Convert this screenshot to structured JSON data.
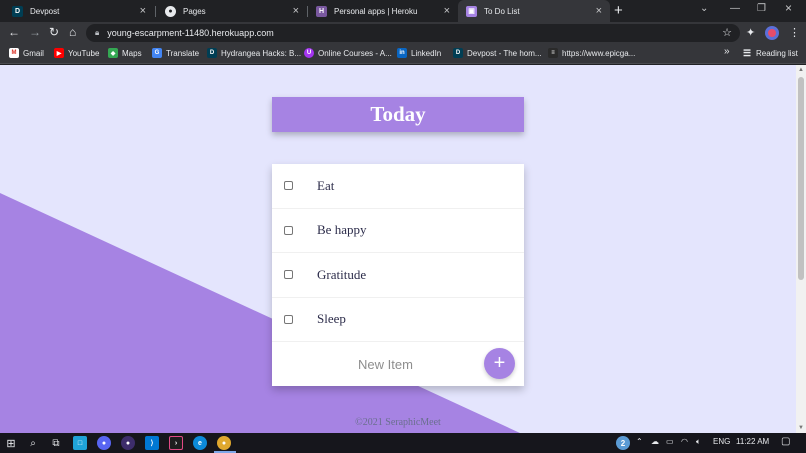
{
  "browser": {
    "tabs": [
      {
        "title": "Devpost",
        "icon": "devpost-icon",
        "active": false
      },
      {
        "title": "Pages",
        "icon": "github-icon",
        "active": false
      },
      {
        "title": "Personal apps | Heroku",
        "icon": "heroku-icon",
        "active": false
      },
      {
        "title": "To Do List",
        "icon": "todo-icon",
        "active": true
      }
    ],
    "url": "young-escarpment-11480.herokuapp.com",
    "bookmarks": [
      {
        "label": "Gmail",
        "icon": "gmail-icon"
      },
      {
        "label": "YouTube",
        "icon": "youtube-icon"
      },
      {
        "label": "Maps",
        "icon": "maps-icon"
      },
      {
        "label": "Translate",
        "icon": "translate-icon"
      },
      {
        "label": "Hydrangea Hacks: B...",
        "icon": "devpost-icon"
      },
      {
        "label": "Online Courses - A...",
        "icon": "online-courses-icon"
      },
      {
        "label": "LinkedIn",
        "icon": "linkedin-icon"
      },
      {
        "label": "Devpost - The hom...",
        "icon": "devpost-icon"
      },
      {
        "label": "https://www.epicga...",
        "icon": "epic-games-icon"
      }
    ],
    "overflow_label": "»",
    "reading_list_label": "Reading list"
  },
  "app": {
    "heading": "Today",
    "items": [
      {
        "text": "Eat",
        "checked": false
      },
      {
        "text": "Be happy",
        "checked": false
      },
      {
        "text": "Gratitude",
        "checked": false
      },
      {
        "text": "Sleep",
        "checked": false
      }
    ],
    "new_item_placeholder": "New Item",
    "add_button_label": "+",
    "footer": "©2021 SeraphicMeet",
    "colors": {
      "accent": "#a683e3",
      "background": "#e4e5fd",
      "card": "#ffffff"
    }
  },
  "taskbar": {
    "language": "ENG",
    "time": "11:22 AM",
    "notification_count": "2"
  }
}
